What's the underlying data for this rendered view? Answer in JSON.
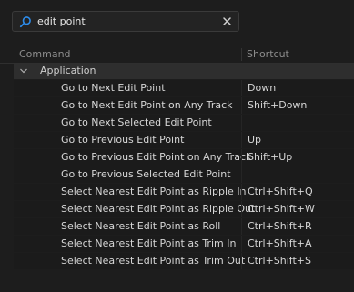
{
  "search": {
    "value": "edit point"
  },
  "columns": {
    "command": "Command",
    "shortcut": "Shortcut"
  },
  "group": {
    "label": "Application",
    "expanded": true
  },
  "commands": [
    {
      "name": "Go to Next Edit Point",
      "shortcut": "Down"
    },
    {
      "name": "Go to Next Edit Point on Any Track",
      "shortcut": "Shift+Down"
    },
    {
      "name": "Go to Next Selected Edit Point",
      "shortcut": ""
    },
    {
      "name": "Go to Previous Edit Point",
      "shortcut": "Up"
    },
    {
      "name": "Go to Previous Edit Point on Any Track",
      "shortcut": "Shift+Up"
    },
    {
      "name": "Go to Previous Selected Edit Point",
      "shortcut": ""
    },
    {
      "name": "Select Nearest Edit Point as Ripple In",
      "shortcut": "Ctrl+Shift+Q"
    },
    {
      "name": "Select Nearest Edit Point as Ripple Out",
      "shortcut": "Ctrl+Shift+W"
    },
    {
      "name": "Select Nearest Edit Point as Roll",
      "shortcut": "Ctrl+Shift+R"
    },
    {
      "name": "Select Nearest Edit Point as Trim In",
      "shortcut": "Ctrl+Shift+A"
    },
    {
      "name": "Select Nearest Edit Point as Trim Out",
      "shortcut": "Ctrl+Shift+S"
    }
  ],
  "icons": {
    "search": "search-icon",
    "clear": "close-icon",
    "group_toggle": "chevron-down-icon"
  },
  "colors": {
    "accent": "#2d8ceb",
    "background": "#1d1d1d",
    "group_row": "#2e2e2e"
  }
}
